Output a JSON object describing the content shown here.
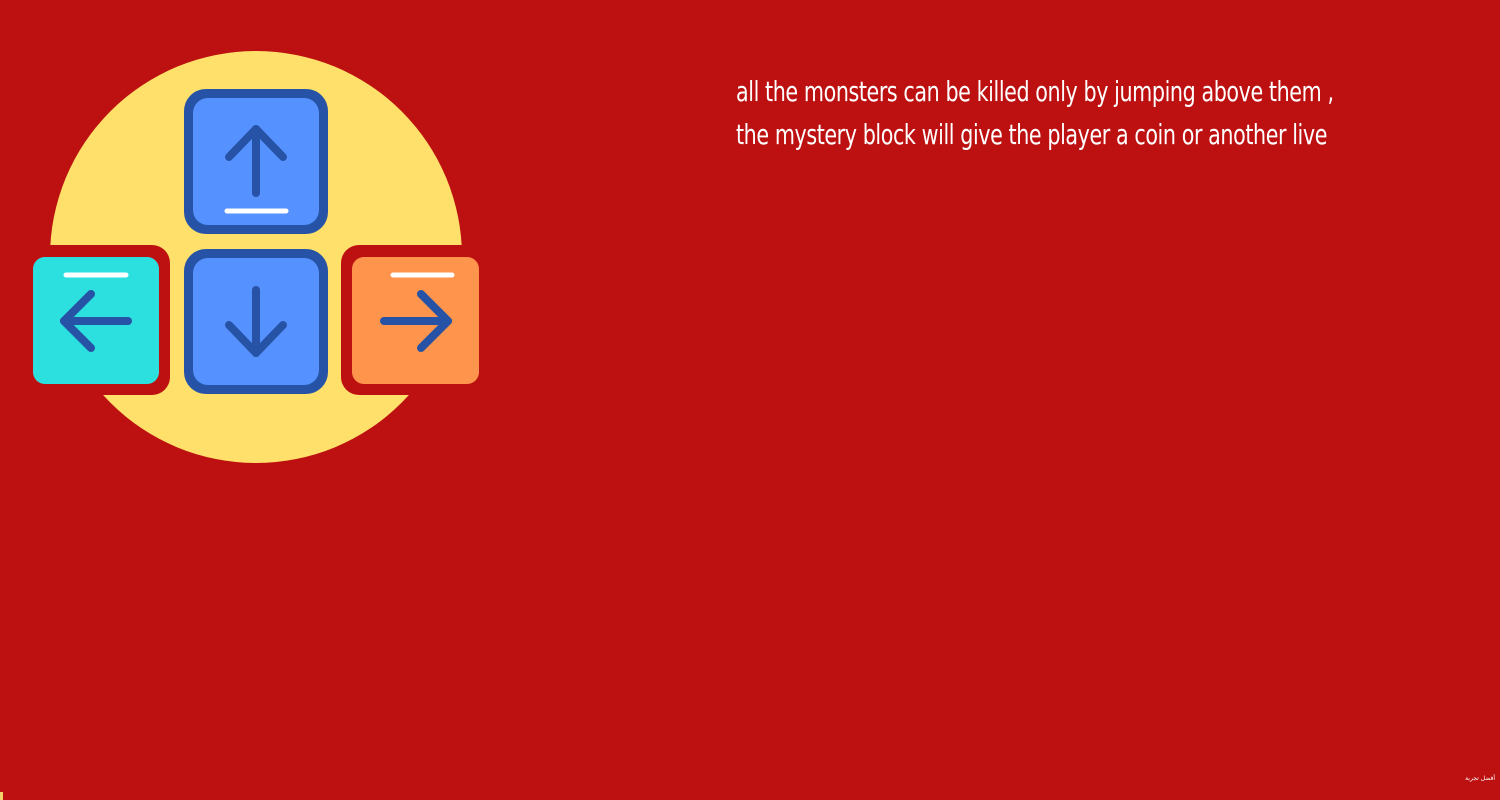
{
  "instructions": {
    "text": "all the monsters can be killed only by jumping above them , the mystery block will give the player a coin or another live"
  },
  "keys": [
    {
      "name": "up",
      "icon": "arrow-up-icon",
      "color": "#5591ff"
    },
    {
      "name": "down",
      "icon": "arrow-down-icon",
      "color": "#5591ff"
    },
    {
      "name": "left",
      "icon": "arrow-left-icon",
      "color": "#2ce0e0"
    },
    {
      "name": "right",
      "icon": "arrow-right-icon",
      "color": "#ff944d"
    }
  ],
  "colors": {
    "background": "#bd1111",
    "circle": "#ffe06a",
    "key_border": "#2653a6",
    "text": "#ffffff"
  },
  "credit": {
    "text": "أفضل تجربة"
  }
}
